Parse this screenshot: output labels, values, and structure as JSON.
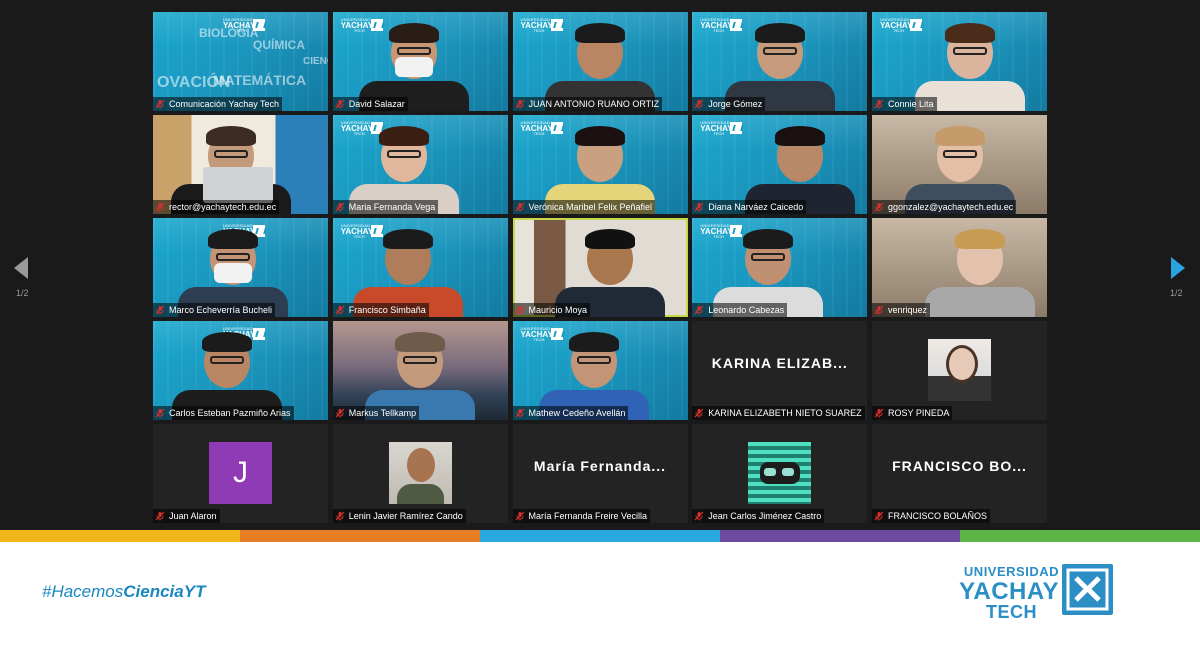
{
  "meeting": {
    "page_indicator": "1/2",
    "participants": [
      {
        "name": "Comunicación Yachay Tech",
        "style": "yt-text"
      },
      {
        "name": "David Salazar",
        "style": "yt-video"
      },
      {
        "name": "JUAN ANTONIO RUANO ORTIZ",
        "style": "yt-video"
      },
      {
        "name": "Jorge Gómez",
        "style": "yt-video"
      },
      {
        "name": "Connie Lita",
        "style": "yt-video"
      },
      {
        "name": "rector@yachaytech.edu.ec",
        "style": "office"
      },
      {
        "name": "Maria Fernanda Vega",
        "style": "yt-video"
      },
      {
        "name": "Verónica Maribel Felix Peñafiel",
        "style": "yt-video"
      },
      {
        "name": "Diana Narváez Caicedo",
        "style": "yt-video"
      },
      {
        "name": "ggonzalez@yachaytech.edu.ec",
        "style": "home"
      },
      {
        "name": "Marco Echeverría Bucheli",
        "style": "yt-video"
      },
      {
        "name": "Francisco Simbaña",
        "style": "yt-video"
      },
      {
        "name": "Mauricio Moya",
        "style": "home-active"
      },
      {
        "name": "Leonardo Cabezas",
        "style": "yt-video"
      },
      {
        "name": "venriquez",
        "style": "home"
      },
      {
        "name": "Carlos Esteban Pazmiño Arias",
        "style": "yt-video"
      },
      {
        "name": "Markus Tellkamp",
        "style": "mountain"
      },
      {
        "name": "Mathew Cedeño Avellán",
        "style": "yt-video"
      },
      {
        "name": "KARINA ELIZABETH NIETO SUAREZ",
        "big_label": "KARINA ELIZAB...",
        "style": "dark-name"
      },
      {
        "name": "ROSY PINEDA",
        "style": "dark-avatar"
      },
      {
        "name": "Juan Alaron",
        "avatar_letter": "J",
        "style": "dark-letter"
      },
      {
        "name": "Lenin Javier Ramírez Cando",
        "style": "dark-photo"
      },
      {
        "name": "María Fernanda Freire Vecilla",
        "big_label": "María Fernanda...",
        "style": "dark-name"
      },
      {
        "name": "Jean Carlos Jiménez Castro",
        "style": "dark-photo2"
      },
      {
        "name": "FRANCISCO BOLAÑOS",
        "big_label": "FRANCISCO BO...",
        "style": "dark-name"
      }
    ],
    "tile_bg_words": [
      "BIOLOGÍA",
      "QUÍMICA",
      "CIENCIA",
      "OVACIÓN",
      "MATEMÁTICA"
    ],
    "logo_text": {
      "uni": "UNIVERSIDAD",
      "yachay": "YACHAY",
      "tech": "TECH"
    }
  },
  "footer": {
    "hashtag_prefix": "#Hacemos",
    "hashtag_bold": "CienciaYT",
    "brand_line1": "UNIVERSIDAD",
    "brand_line2": "YACHAY",
    "brand_line3": "TECH",
    "stripe_colors": [
      "#f2b51b",
      "#e57e25",
      "#29a9df",
      "#6a4b9f",
      "#5bb548"
    ]
  },
  "colors": {
    "accent_active": "#c6d74a",
    "muted_mic": "#d9302c",
    "brand_blue": "#2b8fc6"
  }
}
